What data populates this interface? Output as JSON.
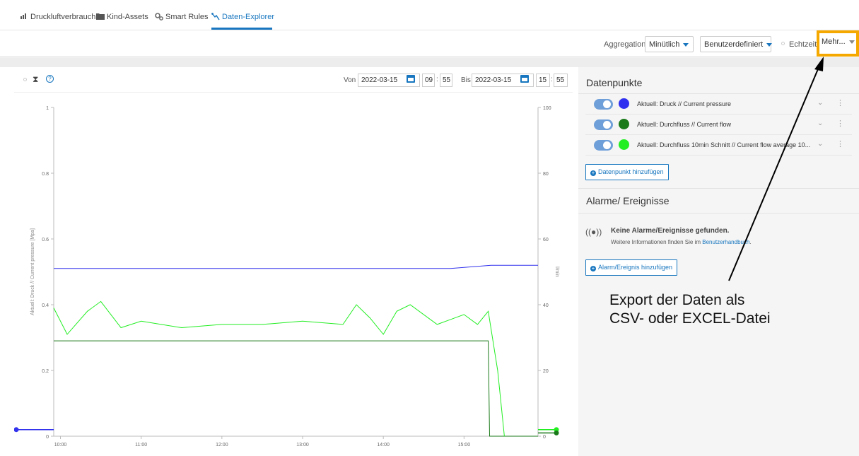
{
  "tabs": [
    {
      "label": "Druckluftverbrauch",
      "icon": "bar-chart-icon",
      "active": false
    },
    {
      "label": "Kind-Assets",
      "icon": "folder-icon",
      "active": false
    },
    {
      "label": "Smart Rules",
      "icon": "gears-icon",
      "active": false
    },
    {
      "label": "Daten-Explorer",
      "icon": "data-explorer-icon",
      "active": true
    }
  ],
  "toolbar": {
    "aggregation_label": "Aggregation",
    "aggregation_value": "Minütlich",
    "range_value": "Benutzerdefiniert",
    "realtime_label": "Echtzeit",
    "more_label": "Mehr..."
  },
  "chart_header": {
    "von_label": "Von",
    "von_date": "2022-03-15",
    "von_hour": "09",
    "von_minute": "55",
    "bis_label": "Bis",
    "bis_date": "2022-03-15",
    "bis_hour": "15",
    "bis_minute": "55",
    "time_sep": ":",
    "hourglass": "⧗",
    "help": "?"
  },
  "chart_data": {
    "type": "line",
    "ylabel_left": "Aktuell: Druck // Current pressure [Mpa]",
    "ylabel_right": "l/min",
    "y_left_ticks": [
      "0",
      "0.2",
      "0.4",
      "0.6",
      "0.8",
      "1"
    ],
    "y_right_ticks": [
      "0",
      "20",
      "40",
      "60",
      "80",
      "100"
    ],
    "x_ticks": [
      "10:00",
      "11:00",
      "12:00",
      "13:00",
      "14:00",
      "15:00"
    ],
    "ylim_left": [
      0,
      1
    ],
    "ylim_right": [
      0,
      100
    ],
    "series": [
      {
        "name": "Aktuell: Druck // Current pressure",
        "color": "#3333ee",
        "axis": "left",
        "x": [
          "09:55",
          "10:20",
          "10:50",
          "11:30",
          "12:20",
          "13:40",
          "14:20",
          "14:50",
          "15:20",
          "15:55"
        ],
        "y": [
          0.51,
          0.51,
          0.51,
          0.51,
          0.51,
          0.51,
          0.51,
          0.51,
          0.52,
          0.52
        ]
      },
      {
        "name": "Aktuell: Durchfluss // Current flow",
        "color": "#1a7a1a",
        "axis": "right",
        "x": [
          "09:55",
          "11:00",
          "12:00",
          "13:00",
          "14:00",
          "15:00",
          "15:18",
          "15:19",
          "15:55"
        ],
        "y": [
          29,
          29,
          29,
          29,
          29,
          29,
          29,
          0,
          0
        ]
      },
      {
        "name": "Aktuell: Durchfluss 10min Schnitt // Current flow average 10...",
        "color": "#22ee22",
        "axis": "right",
        "x": [
          "09:55",
          "10:05",
          "10:20",
          "10:30",
          "10:45",
          "11:00",
          "11:30",
          "12:00",
          "12:30",
          "13:00",
          "13:30",
          "13:40",
          "13:50",
          "14:00",
          "14:10",
          "14:20",
          "14:40",
          "15:00",
          "15:10",
          "15:18",
          "15:25",
          "15:30"
        ],
        "y": [
          39,
          31,
          38,
          41,
          33,
          35,
          33,
          34,
          34,
          35,
          34,
          40,
          36,
          31,
          38,
          40,
          34,
          37,
          34,
          38,
          20,
          0
        ]
      }
    ],
    "endpoint_markers": [
      {
        "side": "left",
        "color": "#3333ee",
        "value": 0.02
      },
      {
        "side": "right",
        "color": "#22ee22",
        "value": 2
      },
      {
        "side": "right",
        "color": "#1a7a1a",
        "value": 1
      }
    ]
  },
  "datapoints": {
    "title": "Datenpunkte",
    "items": [
      {
        "label": "Aktuell: Druck // Current pressure",
        "color": "#2f2ff0"
      },
      {
        "label": "Aktuell: Durchfluss // Current flow",
        "color": "#1a7a1a"
      },
      {
        "label": "Aktuell: Durchfluss 10min Schnitt // Current flow average 10...",
        "color": "#22ee22"
      }
    ],
    "add_button": "Datenpunkt hinzufügen"
  },
  "alarms": {
    "title": "Alarme/ Ereignisse",
    "empty_title": "Keine Alarme/Ereignisse gefunden.",
    "empty_info_prefix": "Weitere Informationen finden Sie im ",
    "empty_info_link": "Benutzerhandbuch",
    "empty_info_suffix": ".",
    "add_button": "Alarm/Ereignis hinzufügen"
  },
  "annotation": {
    "line1": "Export der Daten als",
    "line2": "CSV- oder EXCEL-Datei",
    "highlight_color": "#f5a800"
  }
}
